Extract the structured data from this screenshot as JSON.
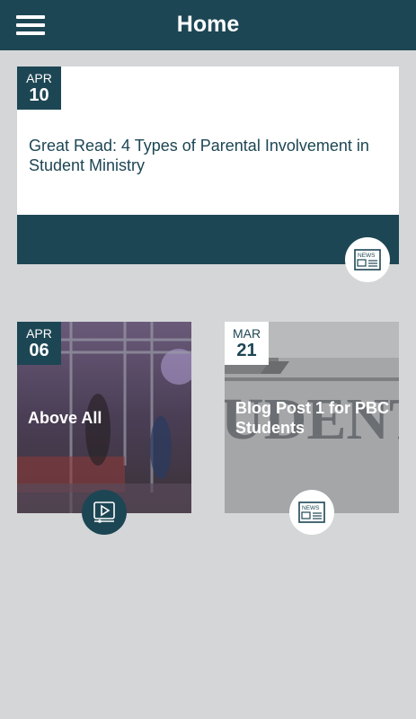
{
  "header": {
    "title": "Home",
    "menu_icon": "hamburger-menu-icon"
  },
  "colors": {
    "primary": "#1d4654",
    "background": "#d4d6d7",
    "card": "#ffffff"
  },
  "featured": {
    "month": "APR",
    "day": "10",
    "title": "Great Read:  4 Types of Parental Involvement in Student Ministry",
    "type_icon": "news-icon"
  },
  "cards": [
    {
      "month": "APR",
      "day": "06",
      "title": "Above All",
      "type_icon": "video-play-icon"
    },
    {
      "month": "MAR",
      "day": "21",
      "title": "Blog Post 1 for PBC Students",
      "type_icon": "news-icon"
    }
  ]
}
